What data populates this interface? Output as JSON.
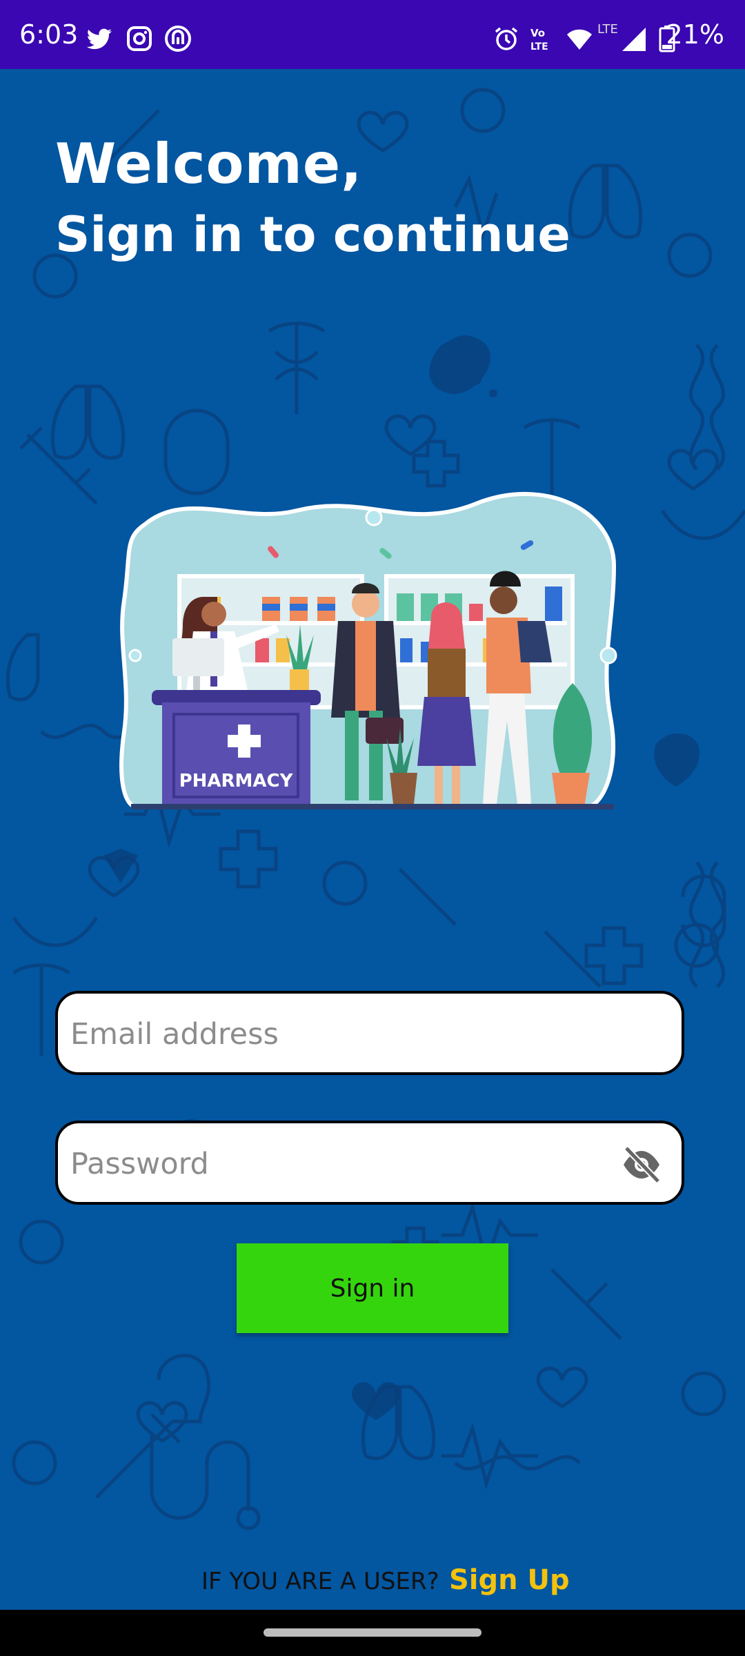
{
  "status_bar": {
    "time": "6:03",
    "battery_percent": "21%",
    "left_icons": [
      "twitter-icon",
      "instagram-icon",
      "app-icon"
    ],
    "right_icons": [
      "alarm-icon",
      "volte-icon",
      "wifi-icon",
      "signal-icon",
      "battery-icon"
    ],
    "network_label": "LTE"
  },
  "header": {
    "title": "Welcome,",
    "subtitle": "Sign in to continue"
  },
  "illustration": {
    "counter_label": "PHARMACY"
  },
  "form": {
    "email_placeholder": "Email address",
    "password_placeholder": "Password",
    "password_visibility": "hidden",
    "sign_in_label": "Sign in"
  },
  "footer": {
    "question": "IF YOU ARE A USER?",
    "signup_label": "Sign Up"
  },
  "colors": {
    "status_bar": "#3a07b2",
    "background": "#0356a0",
    "button": "#35d50e",
    "signup_link": "#f4c20d"
  }
}
